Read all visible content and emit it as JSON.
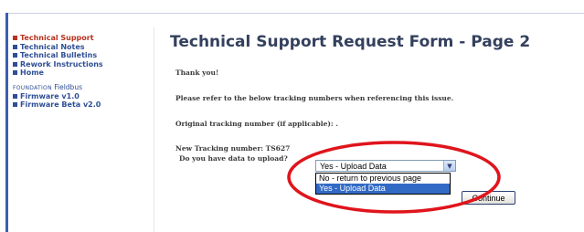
{
  "sidebar": {
    "items": [
      {
        "label": "Technical Support",
        "active": true
      },
      {
        "label": "Technical Notes",
        "active": false
      },
      {
        "label": "Technical Bulletins",
        "active": false
      },
      {
        "label": "Rework Instructions",
        "active": false
      },
      {
        "label": "Home",
        "active": false
      }
    ],
    "section": {
      "heading_caps": "Foundation",
      "heading_rest": " Fieldbus",
      "items": [
        {
          "label": "Firmware v1.0"
        },
        {
          "label": "Firmware Beta v2.0"
        }
      ]
    }
  },
  "main": {
    "title": "Technical Support Request Form - Page 2",
    "thank_you": "Thank you!",
    "refer_text": "Please refer to the below tracking numbers when referencing this issue.",
    "original_tracking": "Original tracking number (if applicable): .",
    "new_tracking": "New Tracking number: TS627",
    "upload_question": "Do you have data to upload?",
    "upload_select": {
      "value": "Yes - Upload Data",
      "options": [
        "No - return to previous page",
        "Yes - Upload Data"
      ],
      "highlighted_index": 1
    },
    "continue_label": "Continue"
  },
  "colors": {
    "accent": "#2f4f95",
    "active": "#b8321f",
    "annotation": "#e0141c",
    "highlight": "#316ac5"
  },
  "icons": {
    "bullet": "square-bullet-icon",
    "dropdown_arrow": "chevron-down-icon"
  }
}
